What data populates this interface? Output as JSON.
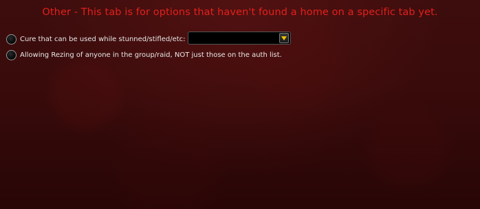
{
  "header": {
    "title": "Other - This tab is for options that haven't found a home on a specific tab yet."
  },
  "options": [
    {
      "label": "Cure that can be used while stunned/stifled/etc:",
      "selected": false
    },
    {
      "label": "Allowing Rezing of anyone in the group/raid, NOT just those on the auth list.",
      "selected": false
    }
  ],
  "cure_dropdown": {
    "value": ""
  },
  "colors": {
    "title": "#e4201c",
    "background": "#3a0b0b",
    "dropdown_arrow": "#f0c000"
  }
}
